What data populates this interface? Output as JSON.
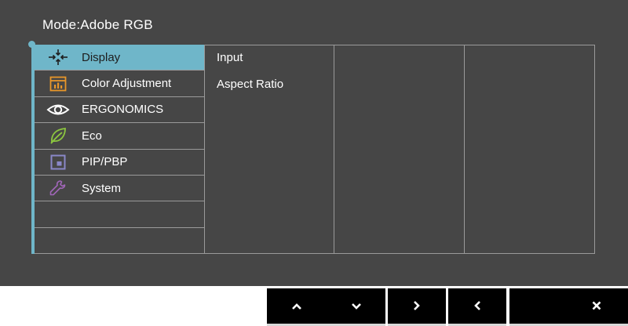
{
  "header": {
    "mode_label": "Mode:",
    "mode_value": "Adobe RGB"
  },
  "menu": {
    "items": [
      {
        "label": "Display",
        "icon": "display-icon",
        "active": true
      },
      {
        "label": "Color Adjustment",
        "icon": "color-adjustment-icon",
        "active": false
      },
      {
        "label": "ERGONOMICS",
        "icon": "eye-icon",
        "active": false
      },
      {
        "label": "Eco",
        "icon": "leaf-icon",
        "active": false
      },
      {
        "label": "PIP/PBP",
        "icon": "pip-icon",
        "active": false
      },
      {
        "label": "System",
        "icon": "wrench-icon",
        "active": false
      }
    ]
  },
  "submenu": {
    "items": [
      "Input",
      "Aspect Ratio"
    ]
  },
  "buttons": [
    {
      "name": "up-button",
      "icon": "chevron-up-icon"
    },
    {
      "name": "down-button",
      "icon": "chevron-down-icon"
    },
    {
      "name": "right-button",
      "icon": "chevron-right-icon"
    },
    {
      "name": "left-button",
      "icon": "chevron-left-icon"
    },
    {
      "name": "close-button",
      "icon": "close-icon"
    }
  ],
  "colors": {
    "accent": "#6fb6c9",
    "background": "#464646",
    "color_adjustment_icon": "#e8962a",
    "ergonomics_icon": "#ffffff",
    "eco_icon": "#8cc63f",
    "pip_icon": "#8a88c8",
    "system_icon": "#a066b8"
  }
}
